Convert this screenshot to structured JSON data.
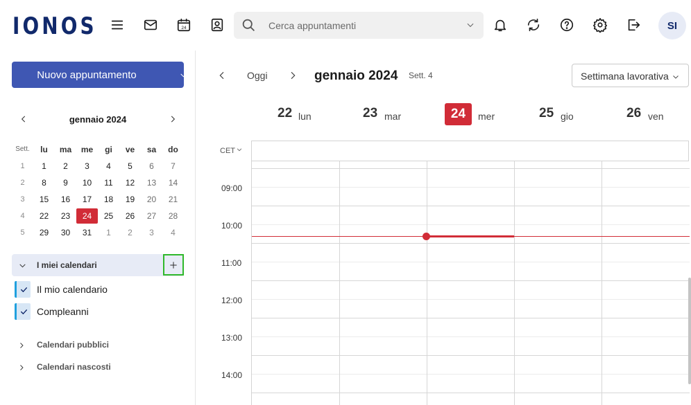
{
  "app": {
    "logo": "IONOS",
    "avatar_initials": "SI"
  },
  "search": {
    "placeholder": "Cerca appuntamenti",
    "value": ""
  },
  "toolbar_icons": [
    "menu-icon",
    "mail-icon",
    "calendar-icon",
    "contacts-icon",
    "bell-icon",
    "refresh-icon",
    "help-icon",
    "settings-icon",
    "logout-icon"
  ],
  "sidebar": {
    "new_button": "Nuovo appuntamento",
    "mini_calendar": {
      "title": "gennaio 2024",
      "week_header": "Sett.",
      "weekdays": [
        "lu",
        "ma",
        "me",
        "gi",
        "ve",
        "sa",
        "do"
      ],
      "weeks": [
        {
          "week": "1",
          "days": [
            "1",
            "2",
            "3",
            "4",
            "5",
            "6",
            "7"
          ]
        },
        {
          "week": "2",
          "days": [
            "8",
            "9",
            "10",
            "11",
            "12",
            "13",
            "14"
          ]
        },
        {
          "week": "3",
          "days": [
            "15",
            "16",
            "17",
            "18",
            "19",
            "20",
            "21"
          ]
        },
        {
          "week": "4",
          "days": [
            "22",
            "23",
            "24",
            "25",
            "26",
            "27",
            "28"
          ]
        },
        {
          "week": "5",
          "days": [
            "29",
            "30",
            "31",
            "1",
            "2",
            "3",
            "4"
          ]
        }
      ],
      "today": "24"
    },
    "my_calendars": {
      "label": "I miei calendari",
      "items": [
        {
          "label": "Il mio calendario",
          "checked": true,
          "color": "#1fa0de"
        },
        {
          "label": "Compleanni",
          "checked": true,
          "color": "#1fa0de"
        }
      ]
    },
    "groups": [
      {
        "label": "Calendari pubblici"
      },
      {
        "label": "Calendari nascosti"
      }
    ]
  },
  "main": {
    "today_label": "Oggi",
    "title": "gennaio 2024",
    "week_label": "Sett. 4",
    "view_select": "Settimana lavorativa",
    "timezone": "CET",
    "days": [
      {
        "num": "22",
        "name": "lun"
      },
      {
        "num": "23",
        "name": "mar"
      },
      {
        "num": "24",
        "name": "mer",
        "today": true
      },
      {
        "num": "25",
        "name": "gio"
      },
      {
        "num": "26",
        "name": "ven"
      }
    ],
    "hours": [
      "09:00",
      "10:00",
      "11:00",
      "12:00",
      "13:00",
      "14:00"
    ]
  },
  "colors": {
    "brand": "#11296b",
    "primary_button": "#3f57b3",
    "today": "#d12c37",
    "highlight": "#e7ebf6",
    "focus_outline": "#2fb82a"
  }
}
